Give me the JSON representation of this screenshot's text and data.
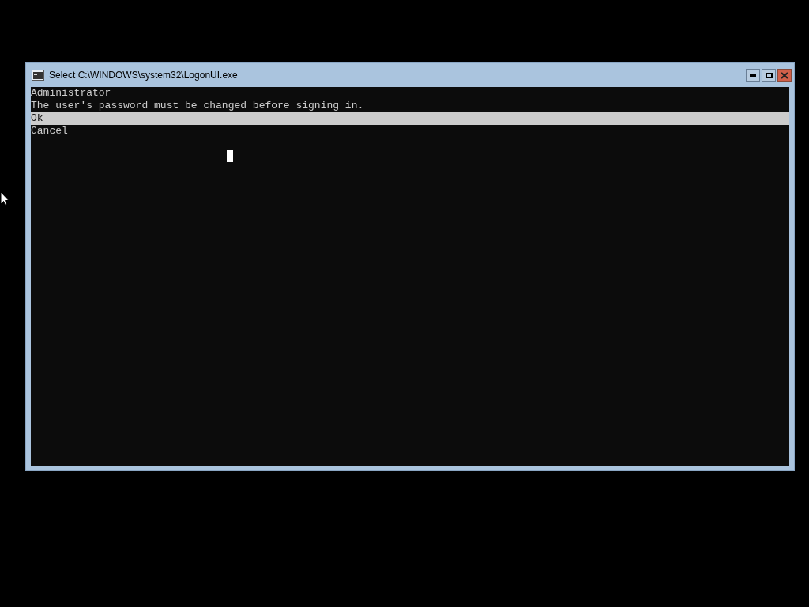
{
  "window": {
    "title": "Select C:\\WINDOWS\\system32\\LogonUI.exe"
  },
  "console": {
    "lines": [
      "Administrator",
      "The user's password must be changed before signing in."
    ],
    "options": [
      {
        "label": "Ok",
        "selected": true
      },
      {
        "label": "Cancel",
        "selected": false
      }
    ]
  }
}
